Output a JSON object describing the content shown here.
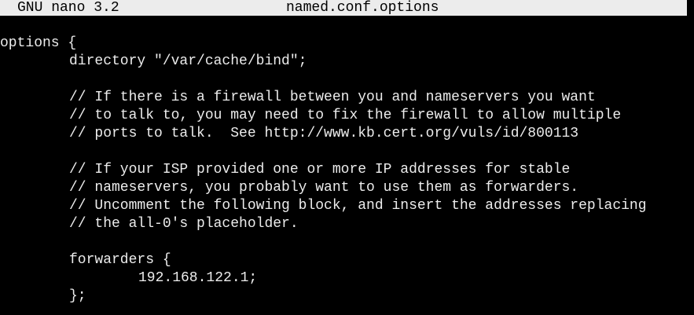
{
  "titlebar": {
    "app": "GNU nano 3.2",
    "filename": "named.conf.options"
  },
  "editor": {
    "lines": [
      "options {",
      "directory \"/var/cache/bind\";",
      "",
      "// If there is a firewall between you and nameservers you want",
      "// to talk to, you may need to fix the firewall to allow multiple",
      "// ports to talk.  See http://www.kb.cert.org/vuls/id/800113",
      "",
      "// If your ISP provided one or more IP addresses for stable",
      "// nameservers, you probably want to use them as forwarders.",
      "// Uncomment the following block, and insert the addresses replacing",
      "// the all-0's placeholder.",
      "",
      "forwarders {",
      "192.168.122.1;",
      "};"
    ]
  },
  "colors": {
    "background": "#000000",
    "foreground": "#ececec",
    "titlebar_bg": "#ececec",
    "titlebar_fg": "#000000"
  }
}
